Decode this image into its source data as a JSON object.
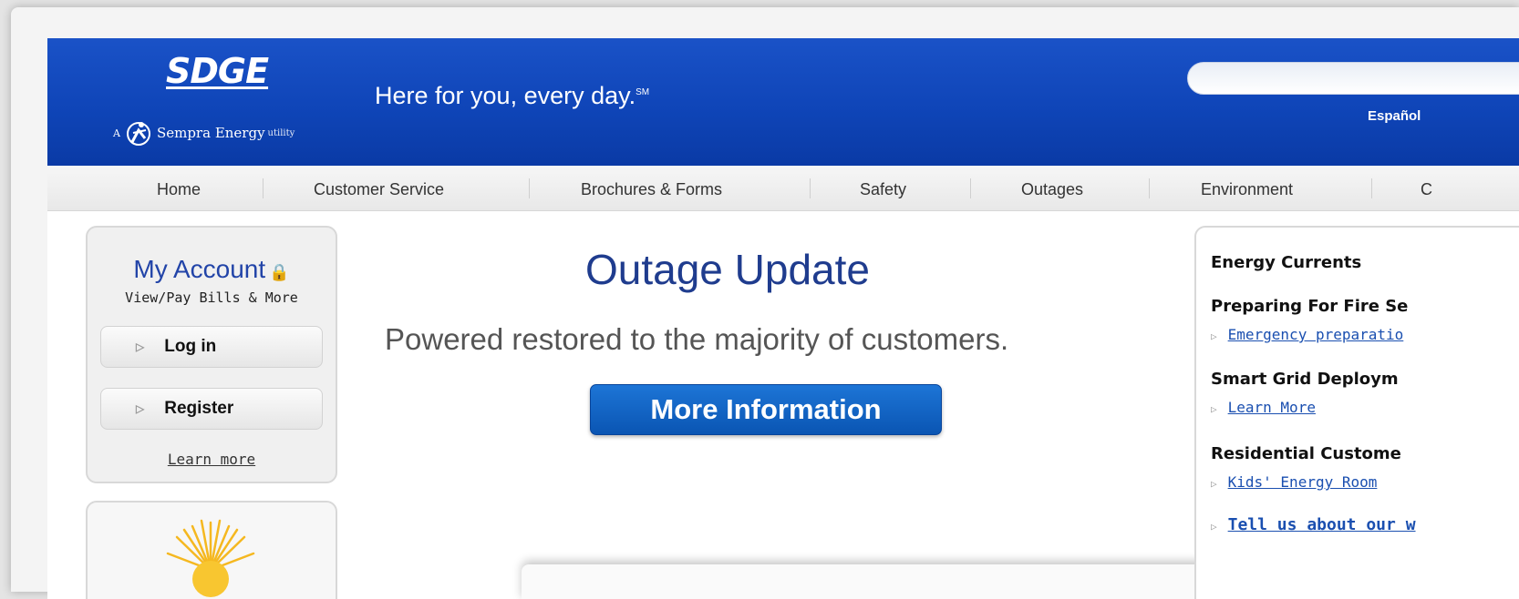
{
  "header": {
    "logo_text": "SDGE",
    "logo_a": "A",
    "logo_company": "Sempra Energy",
    "logo_utility": "utility",
    "tagline": "Here for you, every day.",
    "tagline_mark": "SM",
    "language_link": "Español"
  },
  "nav": {
    "items": [
      "Home",
      "Customer Service",
      "Brochures & Forms",
      "Safety",
      "Outages",
      "Environment",
      "C"
    ]
  },
  "account": {
    "title": "My Account",
    "lock_icon": "lock-icon",
    "subtitle": "View/Pay Bills & More",
    "login_label": "Log in",
    "register_label": "Register",
    "learn_more": "Learn more"
  },
  "main": {
    "title": "Outage Update",
    "subtitle": "Powered restored to the majority of customers.",
    "button_label": "More Information"
  },
  "sidebar": {
    "heading": "Energy Currents",
    "sections": [
      {
        "title": "Preparing For Fire Se",
        "link": "Emergency preparatio"
      },
      {
        "title": "Smart Grid Deploym",
        "link": "Learn More"
      },
      {
        "title": "Residential Custome",
        "link": "Kids' Energy Room"
      }
    ],
    "footer_link": "Tell us about our w"
  },
  "colors": {
    "header_blue": "#0f45b8",
    "title_blue": "#1f3c8e",
    "button_blue": "#0a55b3",
    "link_blue": "#1a4fb0"
  }
}
